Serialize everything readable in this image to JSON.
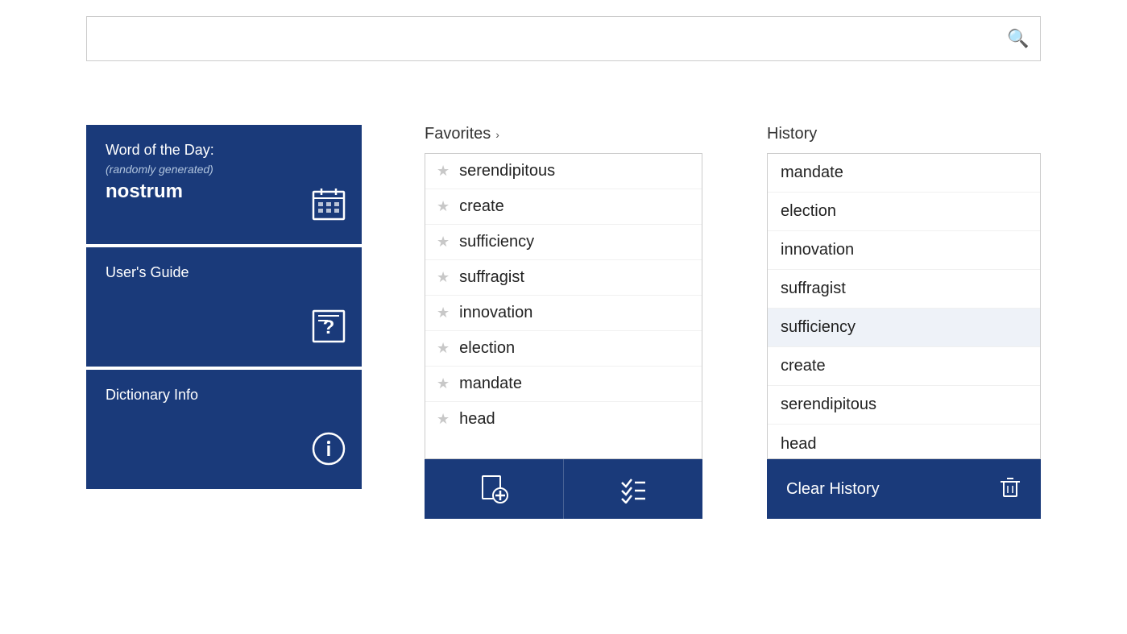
{
  "search": {
    "placeholder": "",
    "value": "",
    "icon": "🔍"
  },
  "left_panel": {
    "word_of_day": {
      "title": "Word of the Day:",
      "subtitle": "(randomly generated)",
      "word": "nostrum",
      "icon": "calendar"
    },
    "users_guide": {
      "title": "User's Guide",
      "icon": "help"
    },
    "dictionary_info": {
      "title": "Dictionary Info",
      "icon": "info"
    }
  },
  "favorites": {
    "header": "Favorites",
    "chevron": "›",
    "items": [
      "serendipitous",
      "create",
      "sufficiency",
      "suffragist",
      "innovation",
      "election",
      "mandate",
      "head"
    ],
    "add_label": "add",
    "manage_label": "manage"
  },
  "history": {
    "header": "History",
    "items": [
      {
        "word": "mandate",
        "highlighted": false
      },
      {
        "word": "election",
        "highlighted": false
      },
      {
        "word": "innovation",
        "highlighted": false
      },
      {
        "word": "suffragist",
        "highlighted": false
      },
      {
        "word": "sufficiency",
        "highlighted": true
      },
      {
        "word": "create",
        "highlighted": false
      },
      {
        "word": "serendipitous",
        "highlighted": false
      },
      {
        "word": "head",
        "highlighted": false
      }
    ],
    "clear_button": "Clear History"
  }
}
